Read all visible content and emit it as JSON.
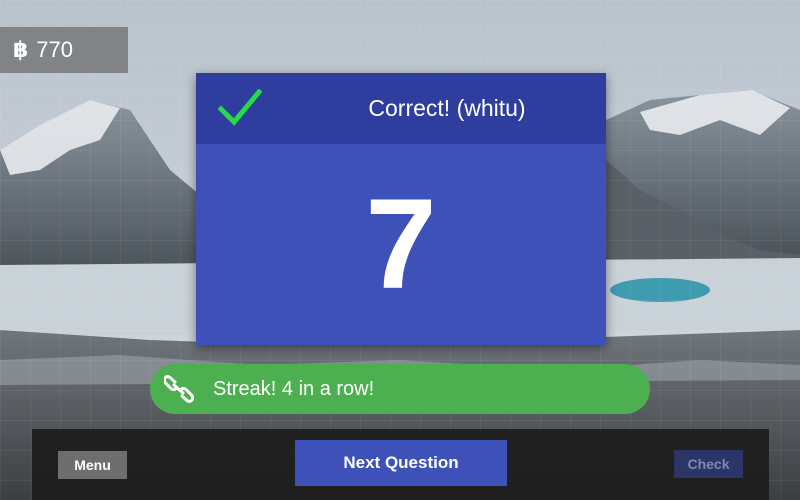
{
  "score": {
    "icon": "bitcoin-icon",
    "value": "770"
  },
  "result": {
    "title": "Correct! (whitu)",
    "icon": "checkmark-icon",
    "number": "7"
  },
  "streak": {
    "icon": "link-chain-icon",
    "text": "Streak! 4 in a row!"
  },
  "controls": {
    "menu_label": "Menu",
    "next_label": "Next Question",
    "check_label": "Check"
  },
  "colors": {
    "header": "#2e3d9e",
    "card": "#3d51b8",
    "streak": "#4caf50",
    "check": "#22dd44",
    "disabled_button": "#2b3568"
  }
}
